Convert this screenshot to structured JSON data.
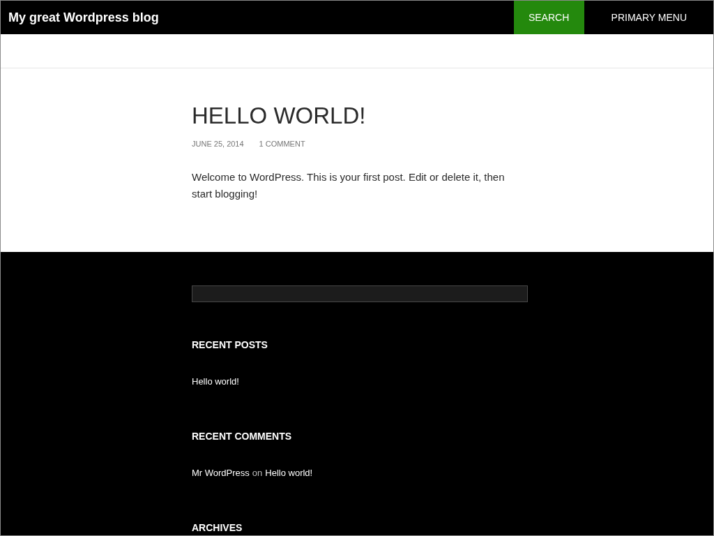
{
  "header": {
    "site_title": "My great Wordpress blog",
    "search_button": "SEARCH",
    "menu_button": "PRIMARY MENU"
  },
  "post": {
    "title": "HELLO WORLD!",
    "date": "JUNE 25, 2014",
    "comments_link": "1 COMMENT",
    "body": "Welcome to WordPress. This is your first post. Edit or delete it, then start blogging!"
  },
  "footer": {
    "widgets": [
      {
        "kind": "search"
      },
      {
        "kind": "posts",
        "title": "RECENT POSTS",
        "items": [
          "Hello world!"
        ]
      },
      {
        "kind": "comments",
        "title": "RECENT COMMENTS",
        "items": [
          {
            "author": "Mr WordPress",
            "connector": "on",
            "post": "Hello world!"
          }
        ]
      },
      {
        "kind": "archives",
        "title": "ARCHIVES"
      }
    ]
  }
}
